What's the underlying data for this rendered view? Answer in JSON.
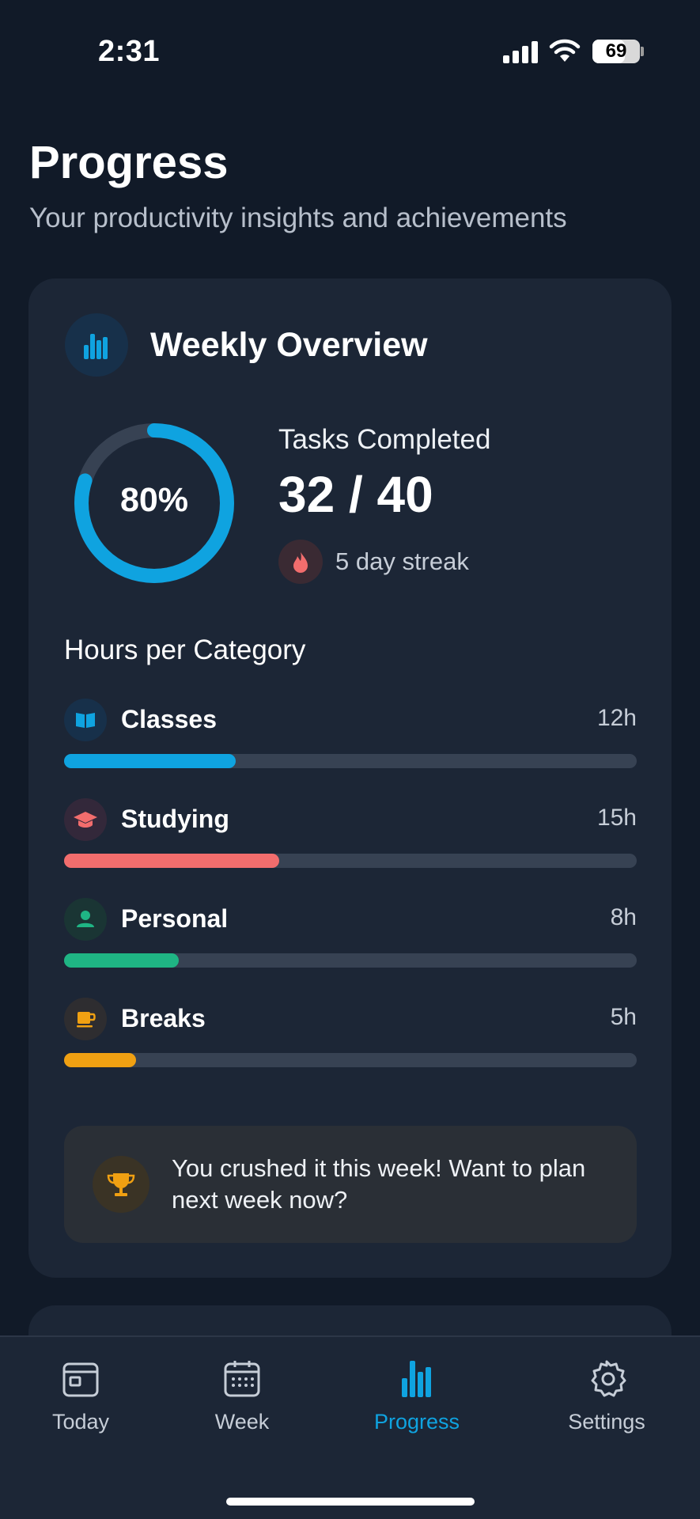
{
  "status_bar": {
    "time": "2:31",
    "battery": "69",
    "battery_level": 0.69
  },
  "header": {
    "title": "Progress",
    "subtitle": "Your productivity insights and achievements"
  },
  "weekly": {
    "title": "Weekly Overview",
    "percent_label": "80%",
    "percent_value": 0.8,
    "tasks_label": "Tasks Completed",
    "tasks_value": "32 / 40",
    "streak": "5 day streak",
    "section_title": "Hours per Category",
    "categories": [
      {
        "label": "Classes",
        "hours": "12h",
        "fraction": 0.3,
        "color": "#0fa3e0",
        "icon": "book-icon"
      },
      {
        "label": "Studying",
        "hours": "15h",
        "fraction": 0.375,
        "color": "#f26d6d",
        "icon": "graduation-cap-icon"
      },
      {
        "label": "Personal",
        "hours": "8h",
        "fraction": 0.2,
        "color": "#1fb584",
        "icon": "person-icon"
      },
      {
        "label": "Breaks",
        "hours": "5h",
        "fraction": 0.125,
        "color": "#f0a012",
        "icon": "coffee-cup-icon"
      }
    ],
    "cta_text": "You crushed it this week! Want to plan next week now?"
  },
  "tabs": [
    {
      "label": "Today",
      "icon": "calendar-day-icon",
      "active": false
    },
    {
      "label": "Week",
      "icon": "calendar-week-icon",
      "active": false
    },
    {
      "label": "Progress",
      "icon": "bar-chart-icon",
      "active": true
    },
    {
      "label": "Settings",
      "icon": "gear-icon",
      "active": false
    }
  ],
  "colors": {
    "background": "#111a28",
    "card": "#1c2636",
    "accent": "#0fa3e0",
    "track": "#374253"
  }
}
